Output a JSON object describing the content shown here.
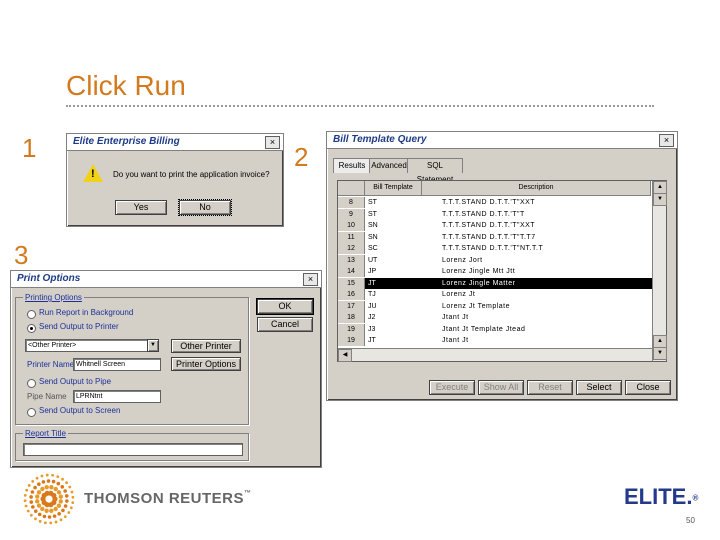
{
  "slide": {
    "title": "Click Run",
    "page_number": "50"
  },
  "steps": {
    "one": "1",
    "two": "2",
    "three": "3"
  },
  "dialog1": {
    "title": "Elite Enterprise Billing",
    "message": "Do you want to print the application invoice?",
    "yes_label": "Yes",
    "no_label": "No",
    "close_glyph": "×",
    "icon": "warning-icon"
  },
  "dialog2": {
    "title": "Bill Template Query",
    "close_glyph": "×",
    "tabs": [
      "Results",
      "Advanced",
      "SQL Statement"
    ],
    "columns": [
      "Bill Template",
      "Description"
    ],
    "rows": [
      {
        "num": "8",
        "template": "ST",
        "desc": "T.T.T.STAND D.T.T.'T\"XXT"
      },
      {
        "num": "9",
        "template": "ST",
        "desc": "T.T.T.STAND D.T.T.'T\"T"
      },
      {
        "num": "10",
        "template": "SN",
        "desc": "T.T.T.STAND D.T.T.'T\"XXT"
      },
      {
        "num": "11",
        "template": "SN",
        "desc": "T.T.T.STAND D.T.T.'T\"T.T7"
      },
      {
        "num": "12",
        "template": "SC",
        "desc": "T.T.T.STAND D.T.T.'T\"NT.T.T"
      },
      {
        "num": "13",
        "template": "UT",
        "desc": "Lorenz Jort"
      },
      {
        "num": "14",
        "template": "JP",
        "desc": "Lorenz Jingle Mtt Jtt"
      },
      {
        "num": "15",
        "template": "JT",
        "desc": "Lorenz Jingle Matter"
      },
      {
        "num": "16",
        "template": "TJ",
        "desc": "Lorenz Jt"
      },
      {
        "num": "17",
        "template": "JU",
        "desc": "Lorenz Jt Template"
      },
      {
        "num": "18",
        "template": "J2",
        "desc": "Jtant Jt"
      },
      {
        "num": "19",
        "template": "J3",
        "desc": "Jtant Jt Template Jtead"
      },
      {
        "num": "19",
        "template": "JT",
        "desc": "Jtant Jt"
      }
    ],
    "selected_index": 7,
    "buttons": [
      "Execute",
      "Show All",
      "Reset",
      "Select",
      "Close"
    ]
  },
  "dialog3": {
    "title": "Print Options",
    "close_glyph": "×",
    "group_label": "Printing Options",
    "opt_background": "Run Report in Background",
    "opt_printer": "Send Output to Printer",
    "printer_select": "<Other Printer>",
    "printer_name_label": "Printer Name",
    "printer_name_value": "Whitnell Screen",
    "other_printer_btn": "Other Printer",
    "printer_options_btn": "Printer Options",
    "opt_pipe": "Send Output to Pipe",
    "pipe_name_label": "Pipe Name",
    "pipe_name_value": "LPRNtnt",
    "opt_screen": "Send Output to Screen",
    "report_title_label": "Report Title",
    "report_title_value": "",
    "ok_label": "OK",
    "cancel_label": "Cancel"
  },
  "footer": {
    "brand": "THOMSON REUTERS",
    "tm": "™",
    "elite": "ELITE.",
    "reg": "®"
  },
  "colors": {
    "accent": "#d27a1d",
    "dialog_gray": "#d4d0c8",
    "label_blue": "#1d2f9a",
    "selection": "#000000"
  }
}
